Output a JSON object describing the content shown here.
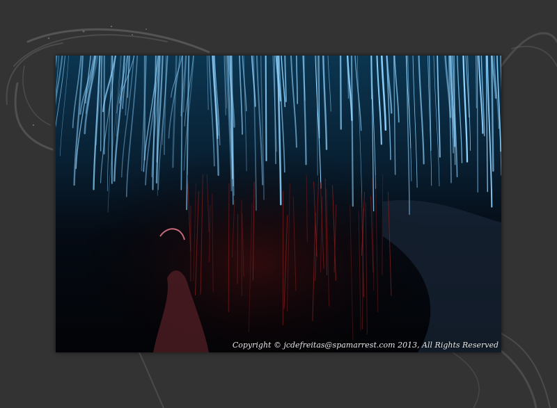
{
  "page": {
    "background_color": "#333333",
    "swirl_color": "#5a5a5a"
  },
  "photo": {
    "subject_colors": {
      "streaks": "#8fd3ff",
      "dark": "#03060b",
      "red_tint": "#7a1c1c"
    },
    "copyright": "Copyright © jcdefreitas@spamarrest.com 2013, All Rights Reserved"
  }
}
